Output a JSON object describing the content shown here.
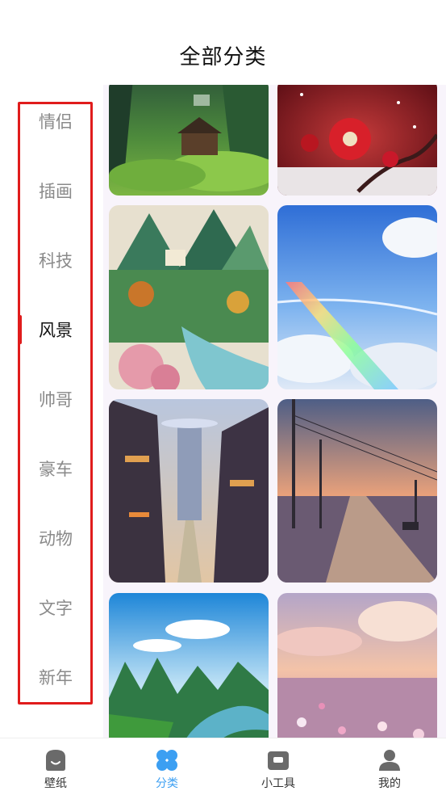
{
  "header": {
    "title": "全部分类"
  },
  "sidebar": {
    "items": [
      {
        "label": "情侣"
      },
      {
        "label": "插画"
      },
      {
        "label": "科技"
      },
      {
        "label": "风景",
        "active": true
      },
      {
        "label": "帅哥"
      },
      {
        "label": "豪车"
      },
      {
        "label": "动物"
      },
      {
        "label": "文字"
      },
      {
        "label": "新年"
      }
    ]
  },
  "wallpapers": [
    {
      "name": "green-forest-village"
    },
    {
      "name": "red-plum-blossom"
    },
    {
      "name": "oriental-landscape-waterfall"
    },
    {
      "name": "rainbow-over-clouds"
    },
    {
      "name": "fantasy-asian-town"
    },
    {
      "name": "sunset-road-powerlines"
    },
    {
      "name": "river-karst-mountains"
    },
    {
      "name": "pink-sky-flower-field"
    }
  ],
  "tabbar": {
    "tabs": [
      {
        "label": "壁纸",
        "icon": "wallpaper-icon"
      },
      {
        "label": "分类",
        "icon": "category-icon",
        "active": true
      },
      {
        "label": "小工具",
        "icon": "toolbox-icon"
      },
      {
        "label": "我的",
        "icon": "profile-icon"
      }
    ]
  },
  "colors": {
    "accent": "#3c9ff2",
    "highlight": "#e01c1c",
    "active_text": "#111111",
    "inactive_text": "#8a8a8a"
  }
}
